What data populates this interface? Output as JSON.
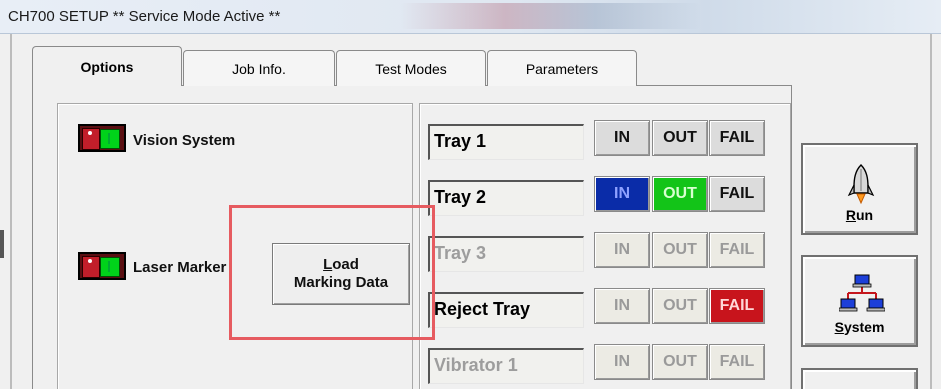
{
  "window": {
    "title": "CH700  SETUP ** Service Mode Active **"
  },
  "tabs": [
    {
      "label": "Options",
      "active": true
    },
    {
      "label": "Job Info.",
      "active": false
    },
    {
      "label": "Test Modes",
      "active": false
    },
    {
      "label": "Parameters",
      "active": false
    }
  ],
  "options": {
    "vision_system_label": "Vision System",
    "laser_marker_label": "Laser Marker",
    "load_marking": {
      "line1": "Load",
      "line2": "Marking Data",
      "underline_char": "L"
    }
  },
  "trays": [
    {
      "name": "Tray 1",
      "enabled": true,
      "in": "IN",
      "out": "OUT",
      "fail": "FAIL",
      "state": "none"
    },
    {
      "name": "Tray 2",
      "enabled": true,
      "in": "IN",
      "out": "OUT",
      "fail": "FAIL",
      "state": "in-out-active"
    },
    {
      "name": "Tray 3",
      "enabled": false,
      "in": "IN",
      "out": "OUT",
      "fail": "FAIL",
      "state": "disabled"
    },
    {
      "name": "Reject Tray",
      "enabled": true,
      "in": "IN",
      "out": "OUT",
      "fail": "FAIL",
      "state": "fail-active"
    },
    {
      "name": "Vibrator 1",
      "enabled": false,
      "in": "IN",
      "out": "OUT",
      "fail": "FAIL",
      "state": "disabled"
    }
  ],
  "side_buttons": {
    "run": {
      "label": "Run",
      "icon": "rocket-icon"
    },
    "system": {
      "label": "System",
      "icon": "network-icon"
    }
  },
  "colors": {
    "in_active": "#0a2ca8",
    "out_active": "#13c418",
    "fail_active": "#c8141c",
    "highlight": "#e65b60"
  }
}
